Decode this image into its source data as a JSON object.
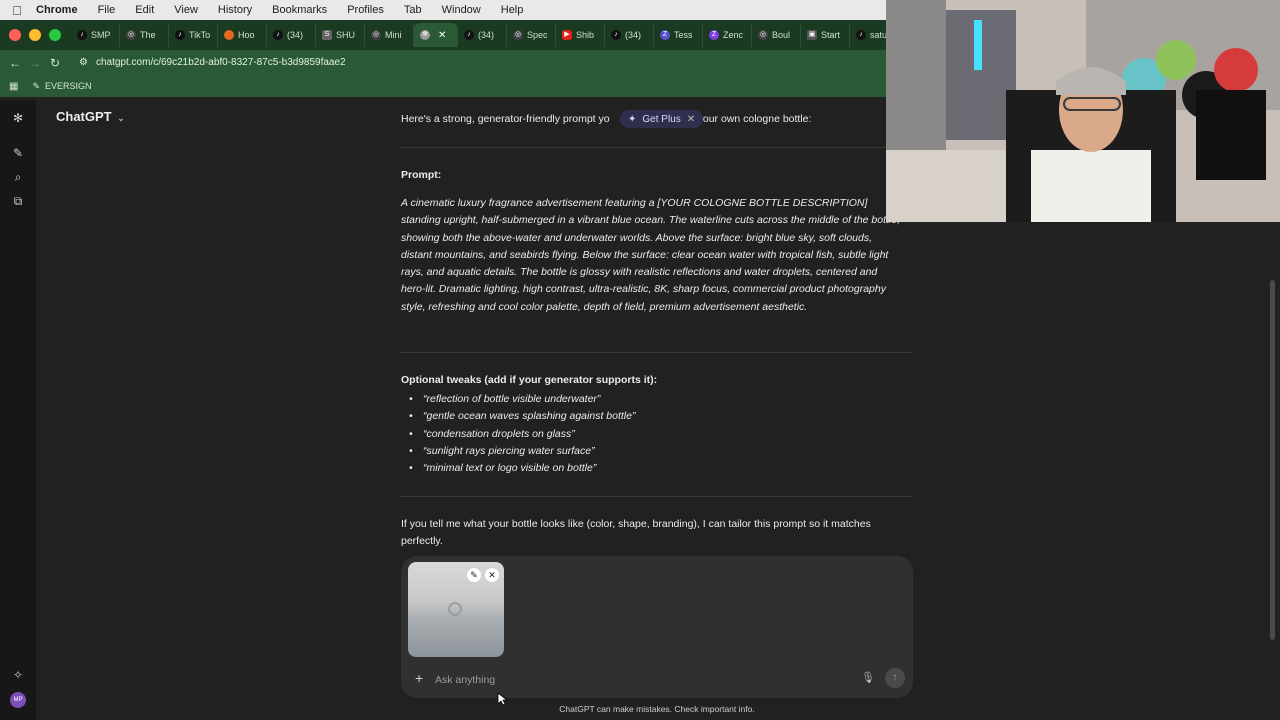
{
  "menubar": {
    "app": "Chrome",
    "items": [
      "File",
      "Edit",
      "View",
      "History",
      "Bookmarks",
      "Profiles",
      "Tab",
      "Window",
      "Help"
    ]
  },
  "tabs": [
    {
      "label": "SMP",
      "icon": "tiktok-icon"
    },
    {
      "label": "The",
      "icon": "globe-icon"
    },
    {
      "label": "TikTo",
      "icon": "tiktok-icon"
    },
    {
      "label": "Hoo",
      "icon": "orange-circle-icon"
    },
    {
      "label": "(34)",
      "icon": "tiktok-icon"
    },
    {
      "label": "SHU",
      "icon": "store-icon"
    },
    {
      "label": "Mini",
      "icon": "globe-icon"
    },
    {
      "label": "",
      "icon": "chatgpt-icon",
      "active": true
    },
    {
      "label": "(34)",
      "icon": "tiktok-icon"
    },
    {
      "label": "Spec",
      "icon": "globe-icon"
    },
    {
      "label": "Shib",
      "icon": "youtube-icon"
    },
    {
      "label": "(34)",
      "icon": "tiktok-icon"
    },
    {
      "label": "Tess",
      "icon": "z-icon"
    },
    {
      "label": "Zenc",
      "icon": "z-icon"
    },
    {
      "label": "Boul",
      "icon": "globe-icon"
    },
    {
      "label": "Start",
      "icon": "cube-icon"
    },
    {
      "label": "satu",
      "icon": "tiktok-icon"
    }
  ],
  "toolbar": {
    "url": "chatgpt.com/c/69c21b2d-abf0-8327-87c5-b3d9859faae2"
  },
  "bookmarks": {
    "item": "EVERSIGN"
  },
  "sidebar": {
    "brand": "ChatGPT"
  },
  "chat": {
    "intro": "Here's a strong, generator-friendly prompt yo",
    "intro_end": "your own cologne bottle:",
    "get_plus": "Get Plus",
    "prompt_heading": "Prompt:",
    "prompt_body": "A cinematic luxury fragrance advertisement featuring a [YOUR COLOGNE BOTTLE DESCRIPTION] standing upright, half-submerged in a vibrant blue ocean. The waterline cuts across the middle of the bottle, showing both the above-water and underwater worlds. Above the surface: bright blue sky, soft clouds, distant mountains, and seabirds flying. Below the surface: clear ocean water with tropical fish, subtle light rays, and aquatic details. The bottle is glossy with realistic reflections and water droplets, centered and hero-lit. Dramatic lighting, high contrast, ultra-realistic, 8K, sharp focus, commercial product photography style, refreshing and cool color palette, depth of field, premium advertisement aesthetic.",
    "tweaks_heading": "Optional tweaks (add if your generator supports it):",
    "tweaks": [
      "“reflection of bottle visible underwater”",
      "“gentle ocean waves splashing against bottle”",
      "“condensation droplets on glass”",
      "“sunlight rays piercing water surface”",
      "“minimal text or logo visible on bottle”"
    ],
    "closing": "If you tell me what your bottle looks like (color, shape, branding), I can tailor this prompt so it matches perfectly."
  },
  "composer": {
    "placeholder": "Ask anything"
  },
  "footer_note": "ChatGPT can make mistakes. Check important info.",
  "avatar_initials": "MP"
}
